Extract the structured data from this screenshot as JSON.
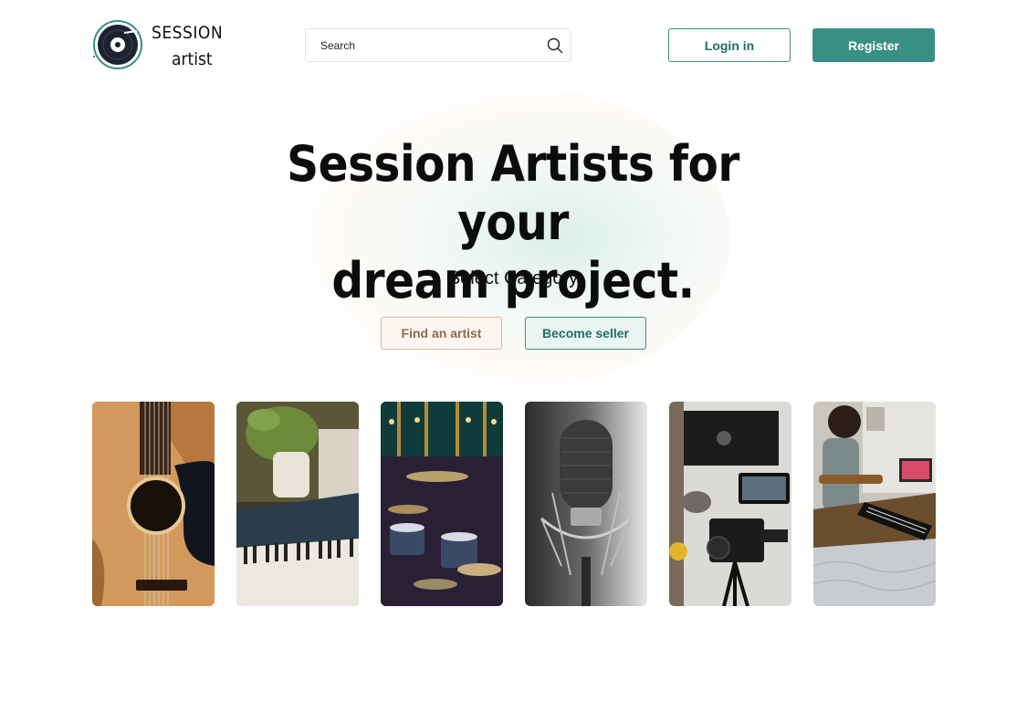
{
  "brand": {
    "line1": "SESSION",
    "line2": "artist"
  },
  "search": {
    "placeholder": "Search"
  },
  "header": {
    "login_label": "Login in",
    "register_label": "Register"
  },
  "hero": {
    "title_line1": "Session Artists for your",
    "title_line2": "dream project.",
    "subtitle": "Select Category"
  },
  "actions": {
    "find_label": "Find an artist",
    "seller_label": "Become seller"
  },
  "colors": {
    "accent": "#3a8f84",
    "accent_dark": "#1f6f66",
    "tan": "#d7b99f"
  },
  "categories": [
    {
      "image": "acoustic-guitar"
    },
    {
      "image": "piano-keys"
    },
    {
      "image": "drum-kit"
    },
    {
      "image": "studio-microphone"
    },
    {
      "image": "video-camera"
    },
    {
      "image": "musician-at-keyboard"
    }
  ]
}
